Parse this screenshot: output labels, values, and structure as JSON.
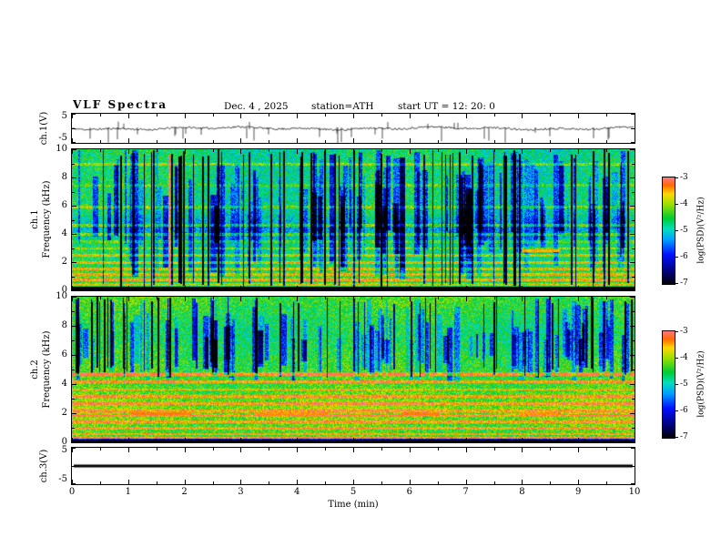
{
  "figure": {
    "title": "VLF Spectra",
    "date": "Dec. 4 , 2025",
    "station": "station=ATH",
    "start_ut": "start UT =  12: 20: 0",
    "background": "#ffffff",
    "axis_color": "#000000"
  },
  "x_axis": {
    "label": "Time (min)",
    "min": 0,
    "max": 10,
    "major_ticks": [
      "0",
      "1",
      "2",
      "3",
      "4",
      "5",
      "6",
      "7",
      "8",
      "9",
      "10"
    ]
  },
  "panels": {
    "waveform": {
      "ylabel": "ch.1(V)",
      "ytick_top": "5",
      "ytick_bottom": "-5",
      "ylim": [
        -5,
        5
      ]
    },
    "spec1": {
      "ylabel_ch": "ch.1",
      "ylabel_freq": "Frequency (kHz)",
      "yticks": [
        "10",
        "8",
        "6",
        "4",
        "2",
        "0"
      ],
      "ylim": [
        0,
        10
      ]
    },
    "spec2": {
      "ylabel_ch": "ch.2",
      "ylabel_freq": "Frequency (kHz)",
      "yticks": [
        "10",
        "8",
        "6",
        "4",
        "2",
        "0"
      ],
      "ylim": [
        0,
        10
      ]
    },
    "ch3": {
      "ylabel": "ch.3(V)",
      "ytick_top": "5",
      "ytick_bottom": "-5",
      "ylim": [
        -5,
        5
      ]
    }
  },
  "colorbar": {
    "label": "log(PSD)(V²/Hz)",
    "min": -7,
    "max": -3,
    "ticks": [
      "-3",
      "-4",
      "-5",
      "-6",
      "-7"
    ],
    "colormap": [
      [
        0,
        "#000000"
      ],
      [
        0.1,
        "#000066"
      ],
      [
        0.28,
        "#0010ff"
      ],
      [
        0.42,
        "#00a0ff"
      ],
      [
        0.52,
        "#00e0c0"
      ],
      [
        0.62,
        "#00cc33"
      ],
      [
        0.75,
        "#99e000"
      ],
      [
        0.85,
        "#ffd800"
      ],
      [
        0.93,
        "#ff6a00"
      ],
      [
        1,
        "#ff7878"
      ]
    ]
  },
  "chart_data": [
    {
      "id": "ch1_waveform",
      "type": "line",
      "ylabel": "ch.1(V)",
      "xlim": [
        0,
        10
      ],
      "ylim": [
        -5,
        5
      ],
      "description": "VLF channel 1 amplitude vs time: noisy trace near 0 V with ~±1 V fluctuation and many impulsive downward spikes reaching -5 V",
      "gen": {
        "seed": 11,
        "noise": 0.35,
        "slow_amp": 0.3,
        "spikes_down": 28,
        "spikes_up": 7,
        "spike_min": 1.5,
        "spike_max": 5
      }
    },
    {
      "id": "ch1_spectrogram",
      "type": "heatmap",
      "ylabel": "ch.1 Frequency (kHz)",
      "xlim": [
        0,
        10
      ],
      "ylim": [
        0,
        10
      ],
      "value_range": [
        -7,
        -3
      ],
      "value_units": "log(PSD)(V²/Hz)",
      "description": "Green speckle background with blue vertical patches and black impulsive vertical lines, bluer region 3-5.5 kHz, bright horizontal tone lines below 3 kHz, black band 0-0.3 kHz, red transient near t=1.7 min, orange dash near 2.85 kHz at t=8-8.6 min",
      "gen": {
        "seed": 7,
        "base": -4.7,
        "speckle": 0.55,
        "xwave": 0.15,
        "streaks": [
          {
            "count": 110,
            "w_min": 2,
            "w_max": 7,
            "k_top_min": 6,
            "k_top_max": 10,
            "k_bot_min": 0.8,
            "k_bot_max": 4.5,
            "d_min": -1.4,
            "d_max": -0.5
          },
          {
            "count": 58,
            "w_min": 1,
            "w_max": 2,
            "k_top_min": 9.5,
            "k_top_max": 10,
            "k_bot_min": 0.3,
            "k_bot_max": 0.6,
            "d_min": -3.5,
            "d_max": -2.0
          }
        ],
        "hot_lines": [
          {
            "x": 1.72,
            "w": 2,
            "k0": 0.4,
            "k1": 9.6,
            "delta": 1.5
          }
        ],
        "bands": [
          {
            "khz": 4.4,
            "hw": 1.4,
            "delta": -0.5,
            "soft": true
          },
          {
            "khz": 8.95,
            "hw": 0.06,
            "delta": 0.7
          },
          {
            "khz": 7.5,
            "hw": 0.05,
            "delta": 0.4
          },
          {
            "khz": 5.95,
            "hw": 0.06,
            "delta": 0.6
          },
          {
            "khz": 4.65,
            "hw": 0.06,
            "delta": 0.9
          },
          {
            "khz": 4.0,
            "hw": 0.05,
            "delta": 0.8
          },
          {
            "khz": 3.5,
            "hw": 0.05,
            "delta": 0.5
          },
          {
            "khz": 3.0,
            "hw": 0.05,
            "delta": 0.6
          },
          {
            "khz": 2.5,
            "hw": 0.06,
            "delta": 0.9
          },
          {
            "khz": 2.0,
            "hw": 0.07,
            "delta": 1.0
          },
          {
            "khz": 1.55,
            "hw": 0.06,
            "delta": 0.9
          },
          {
            "khz": 1.15,
            "hw": 0.05,
            "delta": 0.8
          },
          {
            "khz": 0.8,
            "hw": 0.06,
            "delta": 1.0
          },
          {
            "khz": 0.45,
            "hw": 0.05,
            "delta": 0.8
          },
          {
            "khz": 1.0,
            "hw": 0.9,
            "delta": 0.25,
            "soft": true
          },
          {
            "khz": 0.12,
            "hw": 0.16,
            "delta": -2.6
          }
        ],
        "dashes": [
          {
            "khz": 2.85,
            "hw": 0.08,
            "x0": 8.0,
            "x1": 8.65,
            "value": -3.5
          }
        ]
      }
    },
    {
      "id": "ch2_spectrogram",
      "type": "heatmap",
      "ylabel": "ch.2 Frequency (kHz)",
      "xlim": [
        0,
        10
      ],
      "ylim": [
        0,
        10
      ],
      "value_range": [
        -7,
        -3
      ],
      "value_units": "log(PSD)(V²/Hz)",
      "description": "Upper half green with blue vertical patches and black impulsive lines; lower half yellow-green with many horizontal tone lines (strong yellow near 4.2 and 4.7 kHz), red dashed segments near 2 kHz at t≈1-2, 3.2-4.6, 5.9-6.5, 8-8.6 min, black band 0-0.25 kHz",
      "gen": {
        "seed": 23,
        "base": -4.35,
        "speckle": 0.5,
        "xwave": 0.12,
        "streaks": [
          {
            "count": 95,
            "w_min": 2,
            "w_max": 6,
            "k_top_min": 7,
            "k_top_max": 10,
            "k_bot_min": 4.2,
            "k_bot_max": 6.0,
            "d_min": -1.5,
            "d_max": -0.5
          },
          {
            "count": 50,
            "w_min": 1,
            "w_max": 2,
            "k_top_min": 9.5,
            "k_top_max": 10,
            "k_bot_min": 4.5,
            "k_bot_max": 5.2,
            "d_min": -3.2,
            "d_max": -1.8
          }
        ],
        "hot_lines": [],
        "bands": [
          {
            "khz": 7.5,
            "hw": 2.5,
            "delta": -0.25,
            "soft": true
          },
          {
            "khz": 4.72,
            "hw": 0.07,
            "delta": 1.2
          },
          {
            "khz": 4.2,
            "hw": 0.06,
            "delta": 1.0
          },
          {
            "khz": 3.65,
            "hw": 0.05,
            "delta": 0.7
          },
          {
            "khz": 3.2,
            "hw": 0.05,
            "delta": 0.8
          },
          {
            "khz": 2.7,
            "hw": 0.05,
            "delta": 0.8
          },
          {
            "khz": 2.2,
            "hw": 0.05,
            "delta": 0.7
          },
          {
            "khz": 1.9,
            "hw": 0.06,
            "delta": 0.9
          },
          {
            "khz": 1.45,
            "hw": 0.05,
            "delta": 0.8
          },
          {
            "khz": 1.0,
            "hw": 0.05,
            "delta": 0.9
          },
          {
            "khz": 0.6,
            "hw": 0.05,
            "delta": 0.8
          },
          {
            "khz": 0.3,
            "hw": 0.06,
            "delta": 1.1
          },
          {
            "khz": 2.3,
            "hw": 2.0,
            "delta": 0.3,
            "soft": true
          },
          {
            "khz": 0.1,
            "hw": 0.14,
            "delta": -2.8
          }
        ],
        "dashes": [
          {
            "khz": 2.0,
            "hw": 0.09,
            "x0": 1.05,
            "x1": 2.1,
            "value": -3.3
          },
          {
            "khz": 2.0,
            "hw": 0.09,
            "x0": 3.25,
            "x1": 4.55,
            "value": -3.4
          },
          {
            "khz": 2.0,
            "hw": 0.09,
            "x0": 5.85,
            "x1": 6.5,
            "value": -3.3
          },
          {
            "khz": 2.0,
            "hw": 0.09,
            "x0": 7.95,
            "x1": 8.65,
            "value": -3.4
          }
        ]
      }
    },
    {
      "id": "ch3_waveform",
      "type": "line",
      "ylabel": "ch.3(V)",
      "xlim": [
        0,
        10
      ],
      "ylim": [
        -5,
        5
      ],
      "description": "Channel 3 flat at 0 V (no signal): solid thick black line",
      "gen": {
        "flat": 0,
        "thickness": 3
      }
    }
  ]
}
